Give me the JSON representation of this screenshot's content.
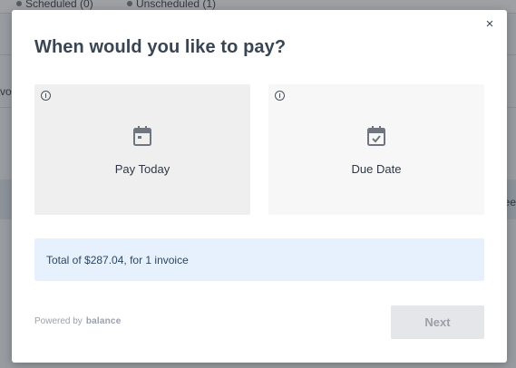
{
  "background": {
    "tabs": [
      {
        "label": "Scheduled (0)"
      },
      {
        "label": "Unscheduled (1)"
      }
    ],
    "left_fragment": "vo",
    "right_fragment": "ee"
  },
  "modal": {
    "close_icon": "×",
    "title": "When would you like to pay?",
    "options": [
      {
        "label": "Pay Today",
        "icon": "calendar-icon",
        "info_icon": "info-icon",
        "selected": true
      },
      {
        "label": "Due Date",
        "icon": "calendar-check-icon",
        "info_icon": "info-icon",
        "selected": false
      }
    ],
    "summary": "Total of $287.04, for 1 invoice",
    "powered_by": "Powered by",
    "brand": "balance",
    "next_label": "Next"
  },
  "colors": {
    "title": "#3a4553",
    "selected_option_bg": "#efeff0",
    "summary_bg": "#e6f1fd",
    "next_disabled_bg": "#e5e6ea"
  }
}
